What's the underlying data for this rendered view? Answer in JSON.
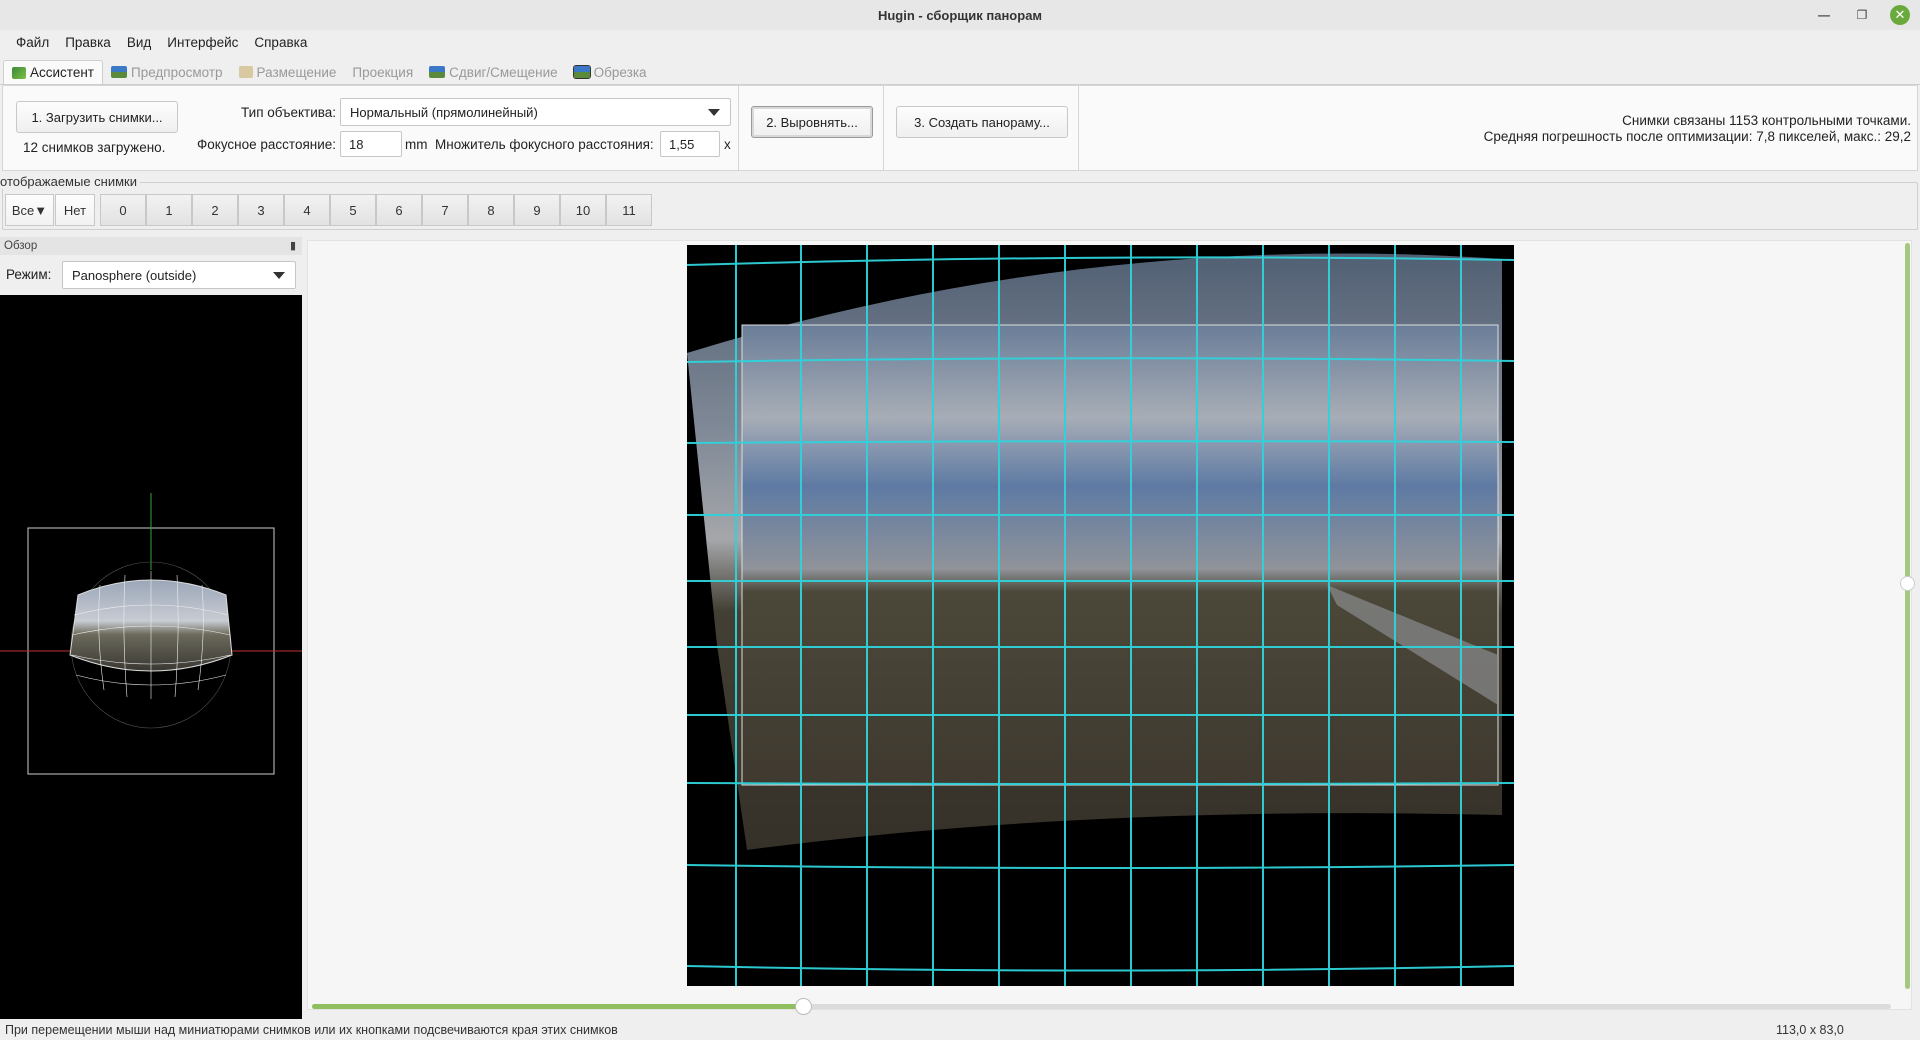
{
  "window": {
    "title": "Hugin - сборщик панорам"
  },
  "menu": [
    "Файл",
    "Правка",
    "Вид",
    "Интерфейс",
    "Справка"
  ],
  "tabs": [
    {
      "label": "Ассистент",
      "active": true
    },
    {
      "label": "Предпросмотр",
      "active": false
    },
    {
      "label": "Размещение",
      "active": false
    },
    {
      "label": "Проекция",
      "active": false
    },
    {
      "label": "Сдвиг/Смещение",
      "active": false
    },
    {
      "label": "Обрезка",
      "active": false
    }
  ],
  "assistant": {
    "load_button": "1. Загрузить снимки...",
    "images_loaded": "12 снимков загружено.",
    "lens_type_label": "Тип объектива:",
    "lens_type_value": "Нормальный (прямолинейный)",
    "focal_label": "Фокусное расстояние:",
    "focal_value": "18",
    "focal_unit": "mm",
    "multiplier_label": "Множитель фокусного расстояния:",
    "multiplier_value": "1,55",
    "multiplier_unit": "x",
    "align_button": "2. Выровнять...",
    "create_button": "3. Создать панораму...",
    "status_line1": "Снимки связаны 1153 контрольными точками.",
    "status_line2": "Средняя погрешность после оптимизации: 7,8 пикселей, макс.: 29,2"
  },
  "displayed_images": {
    "legend": "отображаемые снимки",
    "all_button": "Все▼",
    "none_button": "Нет",
    "numbers": [
      "0",
      "1",
      "2",
      "3",
      "4",
      "5",
      "6",
      "7",
      "8",
      "9",
      "10",
      "11"
    ]
  },
  "overview": {
    "header": "Обзор",
    "mode_label": "Режим:",
    "mode_value": "Panosphere (outside)"
  },
  "status": {
    "message": "При перемещении мыши над миниатюрами снимков или их кнопками подсвечиваются края этих снимков",
    "fov": "113,0 x 83,0"
  },
  "colors": {
    "grid": "#2fd3dc",
    "accent_green": "#8fbf5e",
    "close_button": "#6aaa3c"
  }
}
